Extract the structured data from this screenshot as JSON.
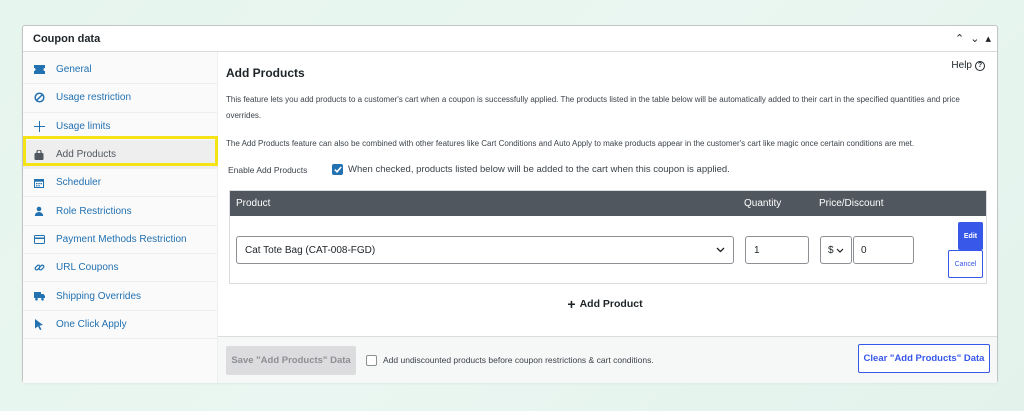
{
  "panel": {
    "title": "Coupon data",
    "controls": [
      "⌃",
      "⌄",
      "▴"
    ]
  },
  "sidebar": {
    "items": [
      {
        "label": "General",
        "icon": "ticket-icon"
      },
      {
        "label": "Usage restriction",
        "icon": "block-icon"
      },
      {
        "label": "Usage limits",
        "icon": "plus-icon"
      },
      {
        "label": "Add Products",
        "icon": "bag-icon",
        "active": true
      },
      {
        "label": "Scheduler",
        "icon": "calendar-icon"
      },
      {
        "label": "Role Restrictions",
        "icon": "user-icon"
      },
      {
        "label": "Payment Methods Restriction",
        "icon": "card-icon"
      },
      {
        "label": "URL Coupons",
        "icon": "link-icon"
      },
      {
        "label": "Shipping Overrides",
        "icon": "truck-icon"
      },
      {
        "label": "One Click Apply",
        "icon": "cursor-icon"
      }
    ]
  },
  "main": {
    "title": "Add Products",
    "help_label": "Help",
    "description1": "This feature lets you add products to a customer's cart when a coupon is successfully applied. The products listed in the table below will be automatically added to their cart in the specified quantities and price overrides.",
    "description2": "The Add Products feature can also be combined with other features like Cart Conditions and Auto Apply to make products appear in the customer's cart like magic once certain conditions are met.",
    "enable_label": "Enable Add Products",
    "enable_checked": true,
    "enable_text": "When checked, products listed below will be added to the cart when this coupon is applied.",
    "table": {
      "headers": {
        "product": "Product",
        "quantity": "Quantity",
        "price": "Price/Discount"
      },
      "rows": [
        {
          "product": "Cat Tote Bag (CAT-008-FGD)",
          "quantity": "1",
          "currency": "$",
          "discount": "0",
          "edit_label": "Edit",
          "cancel_label": "Cancel"
        }
      ]
    },
    "add_product_label": "Add Product"
  },
  "footer": {
    "save_label": "Save \"Add Products\" Data",
    "checkbox_text": "Add undiscounted products before coupon restrictions & cart conditions.",
    "checkbox_checked": false,
    "clear_label": "Clear \"Add Products\" Data"
  },
  "colors": {
    "accent": "#3858e9",
    "link": "#2271b1",
    "highlight": "#f6e316",
    "table_header": "#50575e"
  }
}
